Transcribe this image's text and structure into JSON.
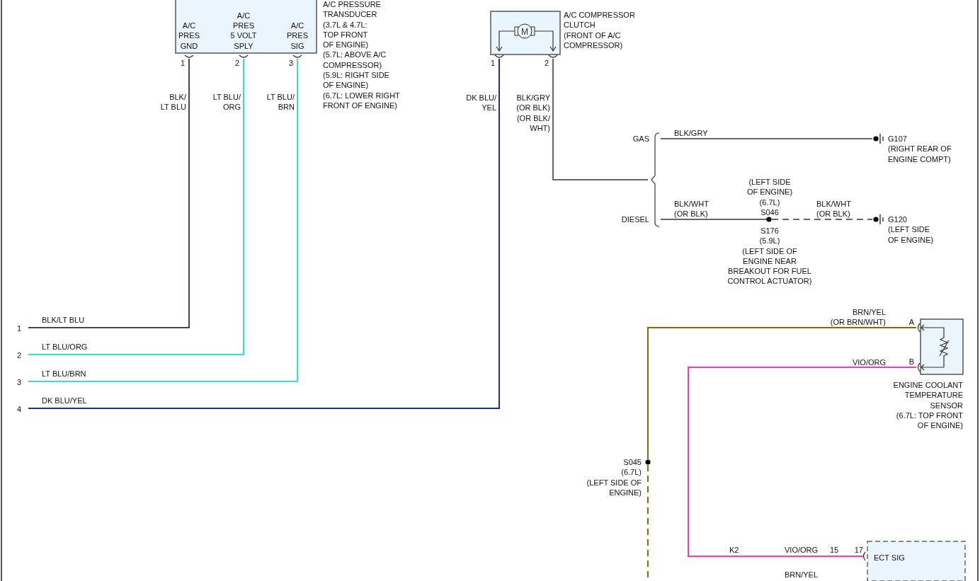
{
  "transducer": {
    "title": "A/C PRESSURE\nTRANSDUCER\n(3.7L & 4.7L:\nTOP FRONT\nOF ENGINE)\n(5.7L: ABOVE A/C\nCOMPRESSOR)\n(5.9L: RIGHT SIDE\nOF ENGINE)\n(6.7L: LOWER RIGHT\nFRONT OF ENGINE)",
    "pins": [
      {
        "label": "A/C\nPRES\nGND",
        "number": "1",
        "wire": "BLK/\nLT BLU"
      },
      {
        "label": "A/C\nPRES\n5 VOLT\nSPLY",
        "number": "2",
        "wire": "LT BLU/\nORG"
      },
      {
        "label": "A/C\nPRES\nSIG",
        "number": "3",
        "wire": "LT BLU/\nBRN"
      }
    ]
  },
  "compressor_clutch": {
    "motor_label": "M",
    "title": "A/C COMPRESSOR\nCLUTCH\n(FRONT OF A/C\nCOMPRESSOR)",
    "pins": [
      {
        "number": "1",
        "wire": "DK BLU/\nYEL"
      },
      {
        "number": "2",
        "wire": "BLK/GRY\n(OR BLK)\n(OR BLK/\nWHT)"
      }
    ]
  },
  "ground_branches": [
    {
      "label": "GAS",
      "wire": "BLK/GRY",
      "ground": "G107\n(RIGHT REAR OF\nENGINE COMPT)"
    },
    {
      "label": "DIESEL",
      "wire": "BLK/WHT\n(OR BLK)",
      "splice_above": "(LEFT SIDE\nOF ENGINE)\n(6.7L)\nS046",
      "splice_below": "S176\n(5.9L)\n(LEFT SIDE OF\nENGINE NEAR\nBREAKOUT FOR FUEL\nCONTROL ACTUATOR)",
      "wire_after_splice": "BLK/WHT\n(OR BLK)",
      "ground": "G120\n(LEFT SIDE\nOF ENGINE)"
    }
  ],
  "connector_pins": [
    {
      "number": "1",
      "wire": "BLK/LT BLU",
      "color": "#3c4a4a"
    },
    {
      "number": "2",
      "wire": "LT BLU/ORG",
      "color": "#33e0d4"
    },
    {
      "number": "3",
      "wire": "LT BLU/BRN",
      "color": "#33e0d4"
    },
    {
      "number": "4",
      "wire": "DK BLU/YEL",
      "color": "#1c2f8a"
    }
  ],
  "coolant_sensor": {
    "title": "ENGINE COOLANT\nTEMPERATURE\nSENSOR\n(6.7L: TOP FRONT\nOF ENGINE)",
    "pins": [
      {
        "letter": "A",
        "wire": "BRN/YEL\n(OR BRN/WHT)",
        "color": "#8a6a00"
      },
      {
        "letter": "B",
        "wire": "VIO/ORG",
        "color": "#ff33cc"
      }
    ]
  },
  "splice_s045": "S045\n(6.7L)\n(LEFT SIDE OF\nENGINE)",
  "module": {
    "connector": "K2",
    "wire": "VIO/ORG",
    "pin_inline": "15",
    "pin_module": "17",
    "label": "ECT SIG",
    "wire_below": "BRN/YEL"
  }
}
